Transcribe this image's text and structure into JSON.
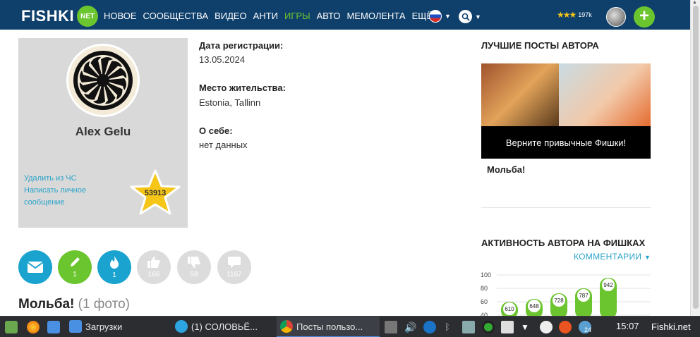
{
  "nav": {
    "logo_text": "FISHKI",
    "logo_badge": "NET",
    "items": [
      {
        "label": "НОВОЕ",
        "active": false
      },
      {
        "label": "СООБЩЕСТВА",
        "active": false
      },
      {
        "label": "ВИДЕО",
        "active": false
      },
      {
        "label": "АНТИ",
        "active": false
      },
      {
        "label": "ИГРЫ",
        "active": true
      },
      {
        "label": "АВТО",
        "active": false
      },
      {
        "label": "МЕМОЛЕНТА",
        "active": false
      },
      {
        "label": "ЕЩЁ",
        "active": false
      }
    ],
    "rating": "197k",
    "add_label": "+"
  },
  "profile": {
    "name": "Alex Gelu",
    "link_remove": "Удалить из ЧС",
    "link_message": "Написать личное сообщение",
    "star_score": "53913"
  },
  "info": {
    "reg_label": "Дата регистрации:",
    "reg_value": "13.05.2024",
    "place_label": "Место жительства:",
    "place_value": "Estonia, Tallinn",
    "about_label": "О себе:",
    "about_value": "нет данных"
  },
  "actions": [
    {
      "icon": "envelope-icon",
      "count": ""
    },
    {
      "icon": "pencil-icon",
      "count": "1"
    },
    {
      "icon": "fire-icon",
      "count": "1"
    },
    {
      "icon": "thumbs-up-icon",
      "count": "166"
    },
    {
      "icon": "thumbs-down-icon",
      "count": "59"
    },
    {
      "icon": "comment-icon",
      "count": "1167"
    }
  ],
  "post": {
    "title": "Мольба!",
    "photo_count": "(1 фото)"
  },
  "sidebar": {
    "best_heading": "ЛУЧШИЕ ПОСТЫ АВТОРА",
    "best_caption": "Верните привычные Фишки!",
    "best_name": "Мольба!",
    "activity_heading": "АКТИВНОСТЬ АВТОРА НА ФИШКАХ",
    "comments_label": "КОММЕНТАРИИ"
  },
  "chart_data": {
    "type": "bar",
    "title": "",
    "xlabel": "",
    "ylabel": "",
    "ylim": [
      0,
      100
    ],
    "yticks": [
      "100",
      "80",
      "60",
      "40"
    ],
    "values": [
      610,
      648,
      728,
      787,
      942
    ],
    "heights": [
      20,
      24,
      32,
      39,
      54
    ]
  },
  "taskbar": {
    "downloads": "Загрузки",
    "telegram": "(1) СОЛОВЬЁ...",
    "chrome": "Посты пользо...",
    "tray_badge": "24",
    "clock": "15:07",
    "watermark": "Fishki.net"
  },
  "colors": {
    "nav_bg": "#0f3f6b",
    "green": "#6bc52f",
    "teal": "#1aa3cf",
    "link": "#2aa3c9"
  }
}
